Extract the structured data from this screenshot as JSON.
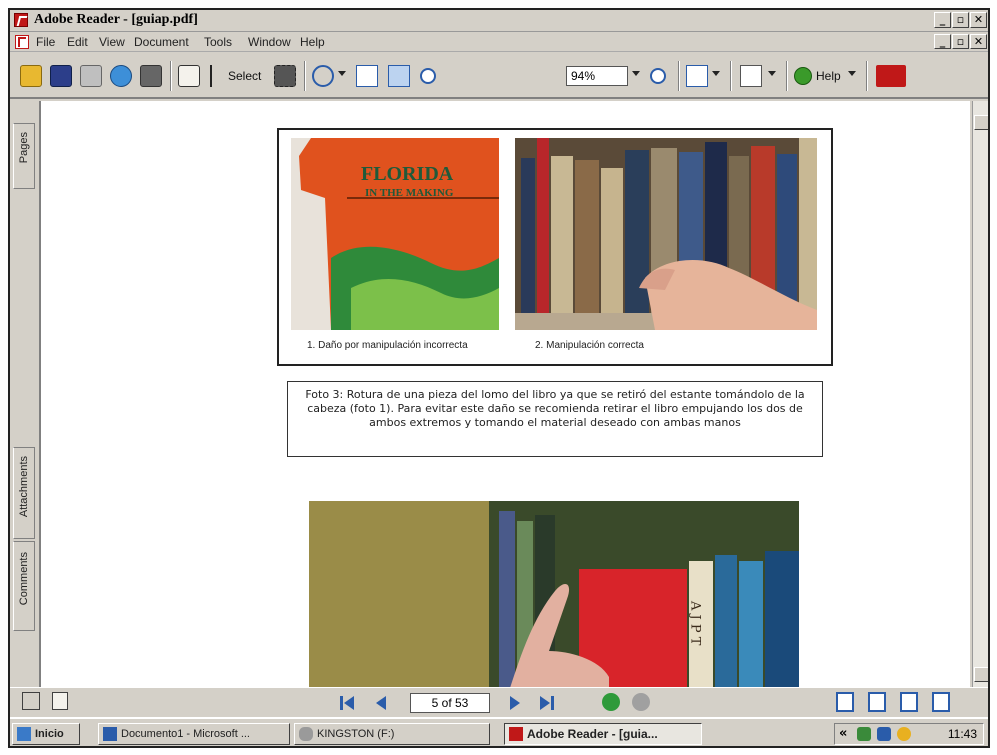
{
  "window": {
    "title": "Adobe Reader - [guiap.pdf]"
  },
  "menu": {
    "items": [
      "File",
      "Edit",
      "View",
      "Document",
      "Tools",
      "Window",
      "Help"
    ]
  },
  "toolbar": {
    "select_label": "Select",
    "zoom_value": "94%",
    "help_label": "Help"
  },
  "navpanel": {
    "tabs": [
      "Pages",
      "Attachments",
      "Comments"
    ]
  },
  "document": {
    "photo1_caption": "1. Daño por manipulación incorrecta",
    "photo2_caption": "2. Manipulación correcta",
    "photo1_book_title_line1": "FLORIDA",
    "photo1_book_title_line2": "IN THE MAKING",
    "figure_caption": "Foto 3: Rotura de una pieza del lomo del libro ya que se retiró del estante tomándolo de la cabeza (foto 1). Para evitar este daño se recomienda retirar el libro empujando los dos de ambos extremos y tomando el material deseado con ambas manos",
    "photo3_spine_text": "A J P T"
  },
  "statusbar": {
    "page_indicator": "5 of 53"
  },
  "taskbar": {
    "start_label": "Inicio",
    "tasks": [
      "Documento1 - Microsoft ...",
      "KINGSTON (F:)",
      "Adobe Reader - [guia..."
    ],
    "tray_chevron": "«",
    "clock": "11:43"
  },
  "colors": {
    "acrobat_red": "#c01818",
    "chrome_gray": "#d4d0c8",
    "link_blue": "#2a5caa"
  }
}
